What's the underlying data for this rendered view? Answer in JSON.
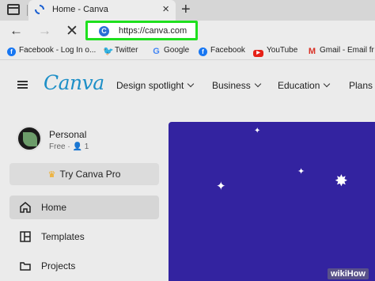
{
  "browser": {
    "tab_title": "Home - Canva",
    "tab_close": "×",
    "new_tab": "+",
    "address": "https://canva.com",
    "address_icon": "C",
    "nav": {
      "back": "←",
      "forward": "→",
      "stop": "✕"
    }
  },
  "bookmarks": [
    {
      "label": "Facebook - Log In o...",
      "icon": "facebook-icon"
    },
    {
      "label": "Twitter",
      "icon": "twitter-icon"
    },
    {
      "label": "Google",
      "icon": "google-icon"
    },
    {
      "label": "Facebook",
      "icon": "facebook-icon"
    },
    {
      "label": "YouTube",
      "icon": "youtube-icon"
    },
    {
      "label": "Gmail - Email fr",
      "icon": "gmail-icon"
    }
  ],
  "canva": {
    "logo": "Canva",
    "topnav": [
      {
        "label": "Design spotlight"
      },
      {
        "label": "Business"
      },
      {
        "label": "Education"
      },
      {
        "label": "Plans a"
      }
    ],
    "account": {
      "name": "Personal",
      "plan": "Free",
      "members": "1"
    },
    "try_pro": "Try Canva Pro",
    "sidebar": [
      {
        "label": "Home",
        "active": true
      },
      {
        "label": "Templates",
        "active": false
      },
      {
        "label": "Projects",
        "active": false
      }
    ]
  },
  "watermark": "wikiHow",
  "colors": {
    "address_highlight": "#1fe01f",
    "canva_brand": "#1d8fc7",
    "hero_background": "#3323a0",
    "crown": "#f3a712"
  }
}
